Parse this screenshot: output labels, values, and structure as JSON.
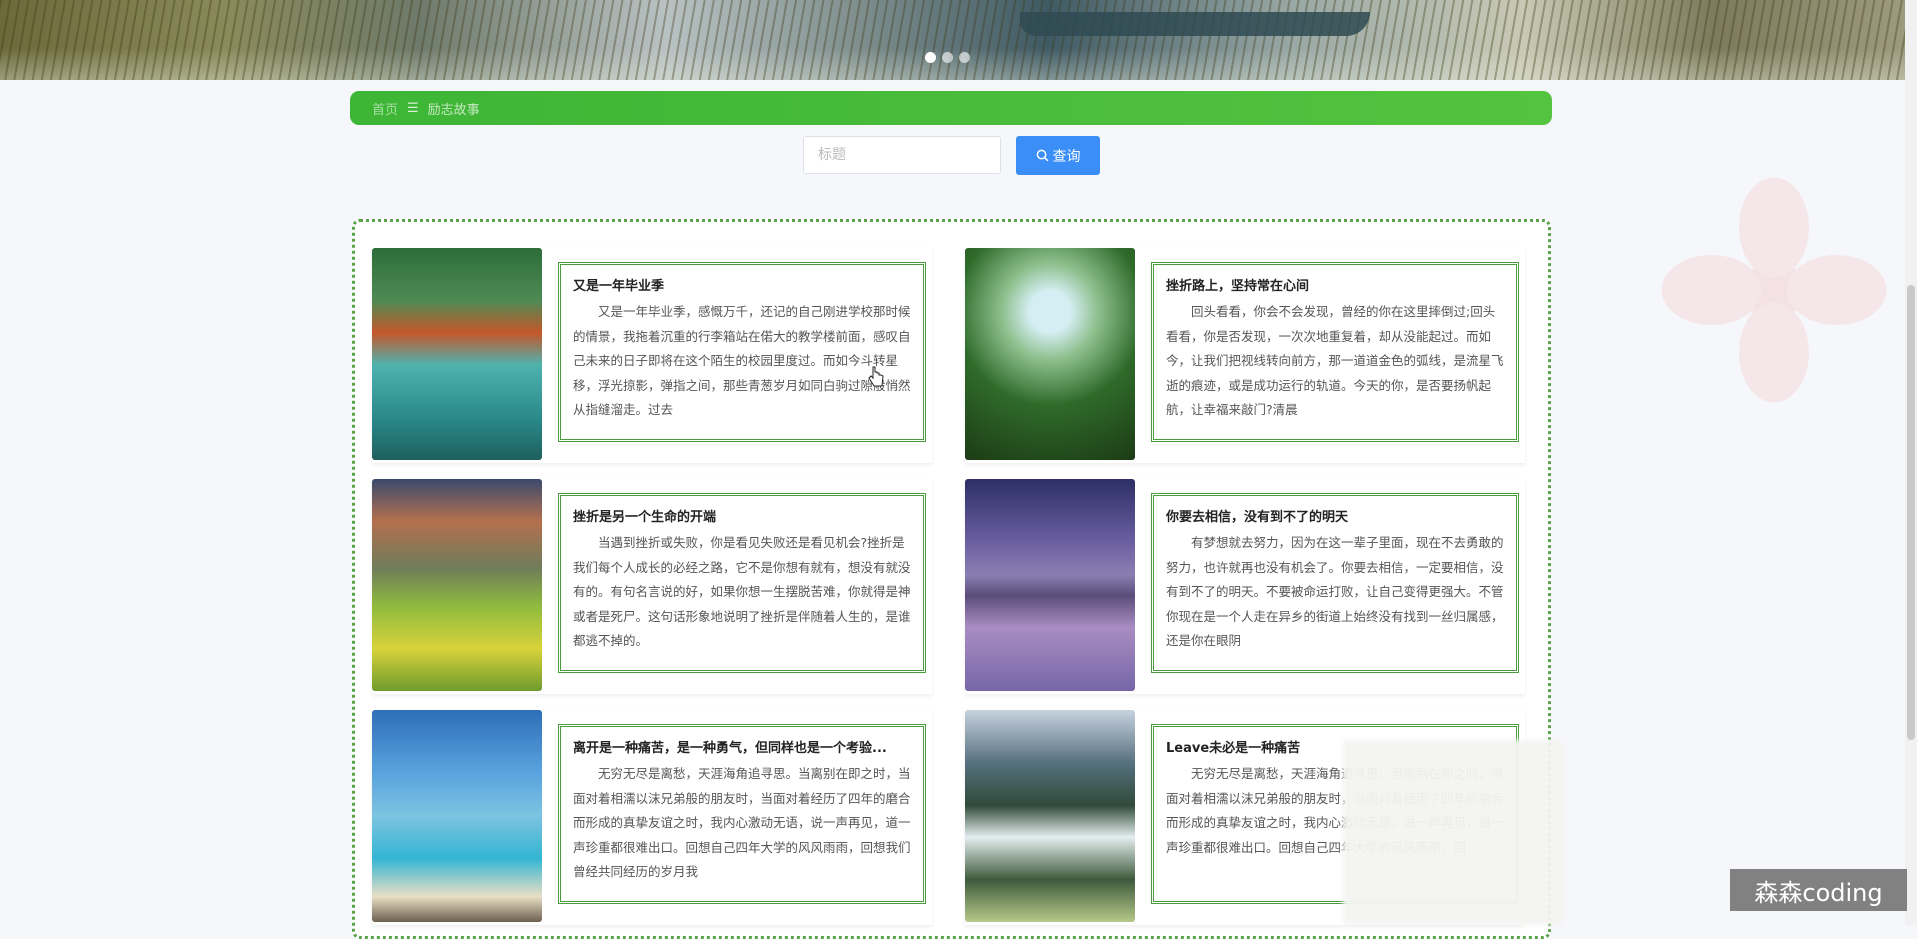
{
  "banner": {
    "slide_dots": [
      true,
      false,
      false
    ]
  },
  "breadcrumb": {
    "home": "首页",
    "separator": "☰",
    "current": "励志故事"
  },
  "search": {
    "placeholder": "标题",
    "button_label": "查询",
    "button_icon": "search-icon"
  },
  "articles": [
    {
      "title": "又是一年毕业季",
      "summary": "又是一年毕业季，感慨万千，还记的自己刚进学校那时候的情景，我拖着沉重的行李箱站在偌大的教学楼前面，感叹自己未来的日子即将在这个陌生的校园里度过。而如今斗转星移，浮光掠影，弹指之间，那些青葱岁月如同白驹过隙般悄然从指缝溜走。过去"
    },
    {
      "title": "挫折路上，坚持常在心间",
      "summary": "回头看看，你会不会发现，曾经的你在这里摔倒过;回头看看，你是否发现，一次次地重复着，却从没能起过。而如今，让我们把视线转向前方，那一道道金色的弧线，是流星飞逝的痕迹，或是成功运行的轨道。今天的你，是否要扬帆起航，让幸福来敲门?清晨"
    },
    {
      "title": "挫折是另一个生命的开端",
      "summary": "当遇到挫折或失败，你是看见失败还是看见机会?挫折是我们每个人成长的必经之路，它不是你想有就有，想没有就没有的。有句名言说的好，如果你想一生摆脱苦难，你就得是神或者是死尸。这句话形象地说明了挫折是伴随着人生的，是谁都逃不掉的。"
    },
    {
      "title": "你要去相信，没有到不了的明天",
      "summary": "有梦想就去努力，因为在这一辈子里面，现在不去勇敢的努力，也许就再也没有机会了。你要去相信，一定要相信，没有到不了的明天。不要被命运打败，让自己变得更强大。不管你现在是一个人走在异乡的街道上始终没有找到一丝归属感，还是你在眼阴"
    },
    {
      "title": "离开是一种痛苦，是一种勇气，但同样也是一个考验...",
      "summary": "无穷无尽是离愁，天涯海角追寻思。当离别在即之时，当面对着相濡以沫兄弟般的朋友时，当面对着经历了四年的磨合而形成的真挚友谊之时，我内心激动无语，说一声再见，道一声珍重都很难出口。回想自己四年大学的风风雨雨，回想我们曾经共同经历的岁月我"
    },
    {
      "title": "Leave未必是一种痛苦",
      "summary": "无穷无尽是离愁，天涯海角追寻思。当离别在即之时，当面对着相濡以沫兄弟般的朋友时，当面对着经历了四年的磨合而形成的真挚友谊之时，我内心激动无语，说一声再见，道一声珍重都很难出口。回想自己四年大学的风风雨雨，回"
    }
  ],
  "watermark": "森森coding",
  "colors": {
    "crumb_bar": "#3db535",
    "search_button": "#3a8ef6",
    "card_border": "#4a9d3d"
  }
}
